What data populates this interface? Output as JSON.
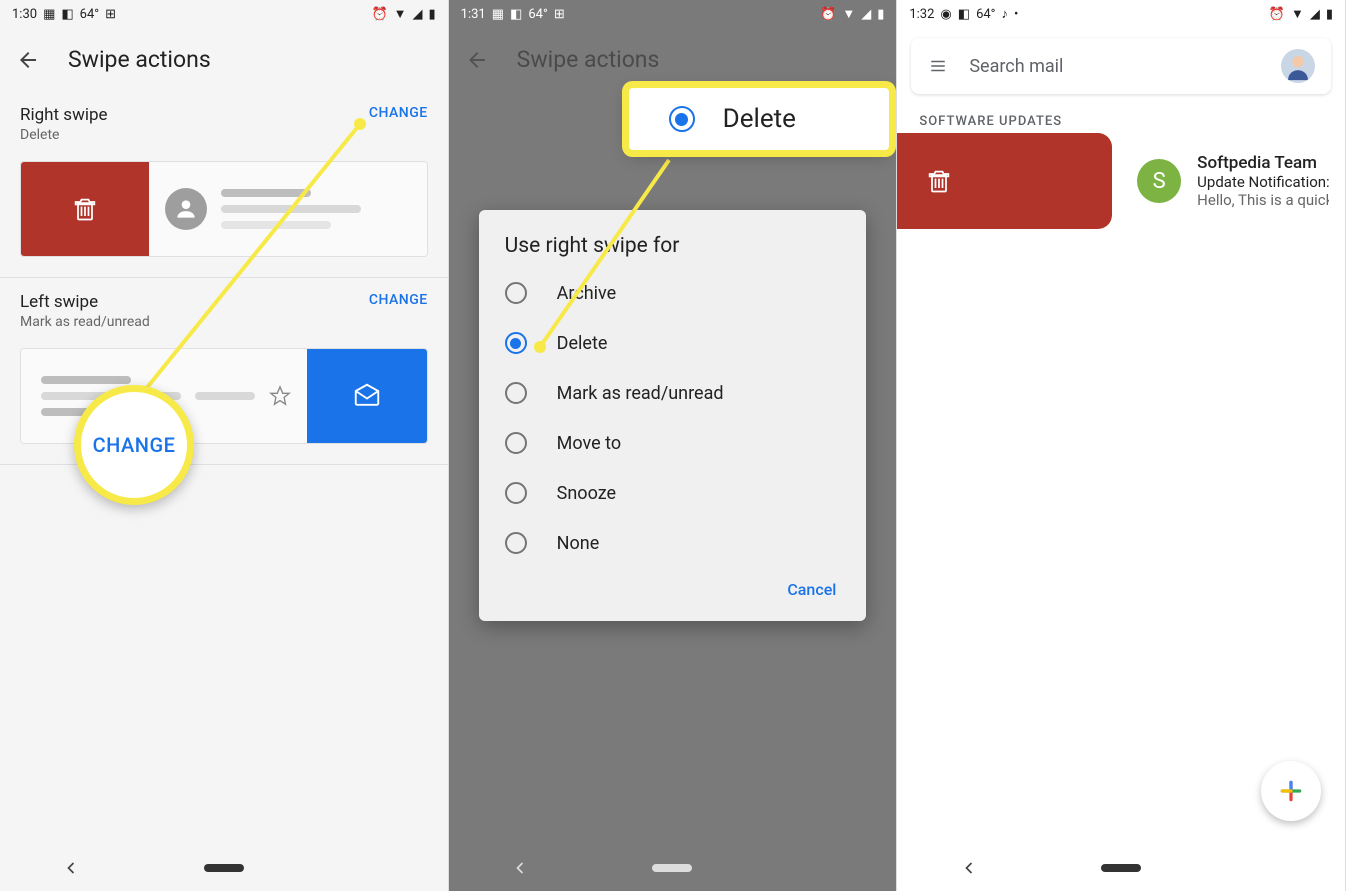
{
  "panel1": {
    "time": "1:30",
    "temp": "64°",
    "title": "Swipe actions",
    "right": {
      "label": "Right swipe",
      "current": "Delete",
      "change": "CHANGE"
    },
    "left": {
      "label": "Left swipe",
      "current": "Mark as read/unread",
      "change": "CHANGE"
    },
    "callout": "CHANGE"
  },
  "panel2": {
    "time": "1:31",
    "temp": "64°",
    "title": "Swipe actions",
    "dialog_title": "Use right swipe for",
    "options": [
      "Archive",
      "Delete",
      "Mark as read/unread",
      "Move to",
      "Snooze",
      "None"
    ],
    "selected": "Delete",
    "cancel": "Cancel",
    "callout": "Delete"
  },
  "panel3": {
    "time": "1:32",
    "search_placeholder": "Search mail",
    "section": "SOFTWARE UPDATES",
    "email": {
      "avatar_letter": "S",
      "avatar_color": "#7cb342",
      "sender": "Softpedia Team",
      "subject": "Update Notification:",
      "preview": "Hello, This is a quick"
    }
  }
}
